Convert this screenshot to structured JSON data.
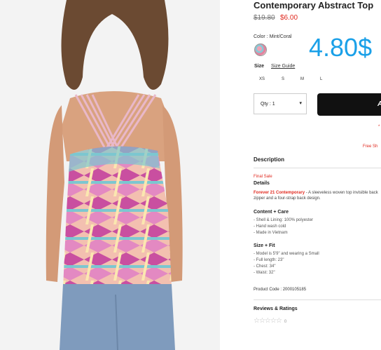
{
  "product": {
    "title": "Contemporary Abstract Top",
    "old_price": "$19.80",
    "sale_price": "$6.00",
    "overlay_price": "4.80$"
  },
  "color": {
    "label": "Color",
    "value": ": Mint/Coral",
    "swatch_icon": "floral-swatch-icon"
  },
  "size": {
    "label": "Size",
    "guide": "Size Guide",
    "options": [
      "XS",
      "S",
      "M",
      "L"
    ]
  },
  "quantity": {
    "label": "Qty : 1",
    "icon": "caret-down-icon"
  },
  "cart": {
    "button_label": "A",
    "note_marker": "*",
    "free_shipping": "Free Sh"
  },
  "description": {
    "heading": "Description",
    "final_sale": "Final Sale",
    "details_heading": "Details",
    "brand": "Forever 21 Contemporary",
    "details_text": " - A sleeveless woven top invisible back zipper and a four-strap back design.",
    "content_heading": "Content + Care",
    "content_items": [
      "- Shell & Lining: 100% polyester",
      "- Hand wash cold",
      "- Made in Vietnam"
    ],
    "size_fit_heading": "Size + Fit",
    "size_fit_items": [
      "- Model is 5'9\" and wearing a Small",
      "- Full length: 23\"",
      "- Chest: 34\"",
      "- Waist: 32\""
    ],
    "product_code": "Product Code : 2000105185"
  },
  "reviews": {
    "heading": "Reviews & Ratings",
    "stars": "☆☆☆☆☆",
    "count": "0",
    "rating": 0
  },
  "colors": {
    "accent_blue": "#1aa0e8",
    "sale_red": "#e0291f",
    "button_black": "#111111"
  }
}
